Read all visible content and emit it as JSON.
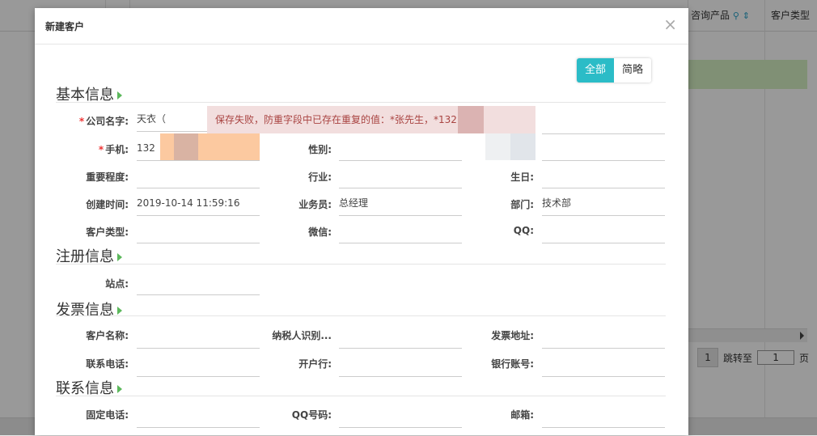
{
  "background": {
    "columns": [
      "咨询产品",
      "客户类型"
    ],
    "pager": {
      "page": "1",
      "jump_label": "跳转至",
      "jump_value": "1",
      "page_suffix": "页"
    }
  },
  "modal": {
    "title": "新建客户",
    "close": "×",
    "toggle": {
      "all": "全部",
      "brief": "简略"
    }
  },
  "toast": "保存失败，防重字段中已存在重复的值：*张先生，*132",
  "sections": {
    "basic": "基本信息",
    "register": "注册信息",
    "invoice": "发票信息",
    "contact": "联系信息"
  },
  "fields": {
    "company": {
      "label": "公司名字:",
      "value": "天衣（"
    },
    "mobile": {
      "label": "手机:",
      "value": "132"
    },
    "gender": {
      "label": "性别:",
      "value": ""
    },
    "importance": {
      "label": "重要程度:",
      "value": ""
    },
    "industry": {
      "label": "行业:",
      "value": ""
    },
    "birthday": {
      "label": "生日:",
      "value": ""
    },
    "created": {
      "label": "创建时间:",
      "value": "2019-10-14 11:59:16"
    },
    "salesman": {
      "label": "业务员:",
      "value": "总经理"
    },
    "department": {
      "label": "部门:",
      "value": "技术部"
    },
    "customer_type": {
      "label": "客户类型:",
      "value": ""
    },
    "wechat": {
      "label": "微信:",
      "value": ""
    },
    "qq": {
      "label": "QQ:",
      "value": ""
    },
    "site": {
      "label": "站点:",
      "value": ""
    },
    "customer_name": {
      "label": "客户名称:",
      "value": ""
    },
    "taxpayer_id": {
      "label": "纳税人识别...",
      "value": ""
    },
    "invoice_address": {
      "label": "发票地址:",
      "value": ""
    },
    "phone": {
      "label": "联系电话:",
      "value": ""
    },
    "bank": {
      "label": "开户行:",
      "value": ""
    },
    "bank_account": {
      "label": "银行账号:",
      "value": ""
    },
    "landline": {
      "label": "固定电话:",
      "value": ""
    },
    "qq_number": {
      "label": "QQ号码:",
      "value": ""
    },
    "email": {
      "label": "邮箱:",
      "value": ""
    }
  }
}
